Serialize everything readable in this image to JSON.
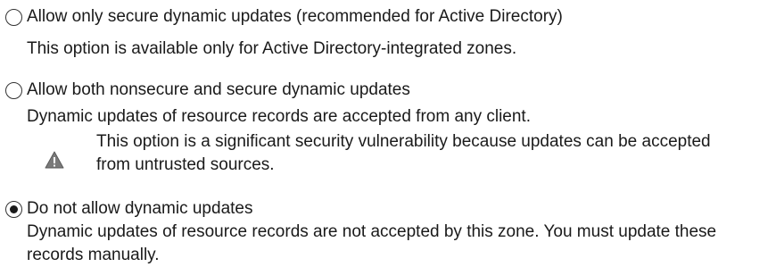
{
  "options": [
    {
      "label": "Allow only secure dynamic updates (recommended for Active Directory)",
      "checked": false,
      "description": "This option is available only for Active Directory-integrated zones."
    },
    {
      "label": "Allow both nonsecure and secure dynamic updates",
      "checked": false,
      "description": "Dynamic updates of resource records are accepted from any client.",
      "warning": {
        "icon": "warning-triangle-icon",
        "text": "This option is a significant security vulnerability because updates can be accepted from untrusted sources."
      }
    },
    {
      "label": "Do not allow dynamic updates",
      "checked": true,
      "description": "Dynamic updates of resource records are not accepted by this zone. You must update these records manually."
    }
  ]
}
